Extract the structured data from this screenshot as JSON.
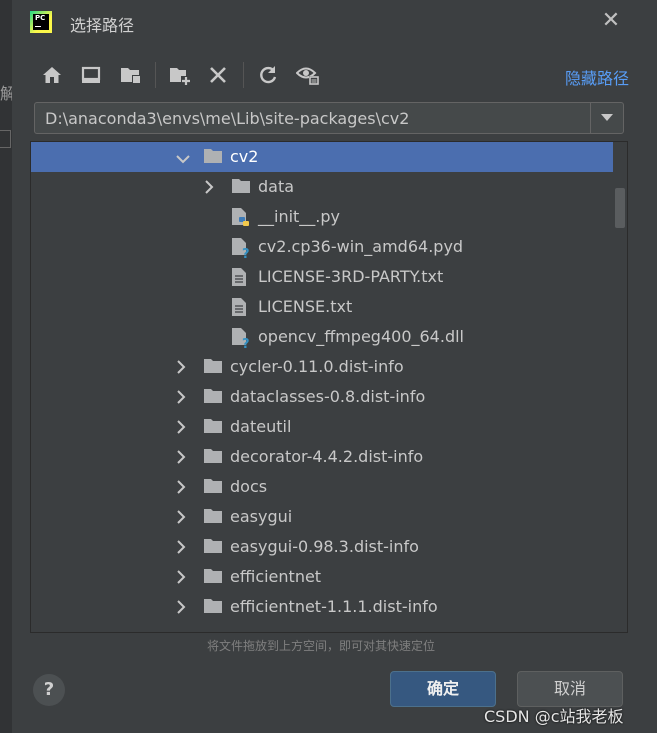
{
  "window": {
    "title": "选择路径",
    "close_glyph": "✕"
  },
  "background_fragments": {
    "left_text": "解"
  },
  "toolbar": {
    "icons": [
      "home-icon",
      "desktop-icon",
      "project-folder-icon",
      "new-folder-icon",
      "delete-icon",
      "refresh-icon",
      "show-hidden-icon"
    ],
    "hide_path_label": "隐藏路径"
  },
  "path": {
    "value": "D:\\anaconda3\\envs\\me\\Lib\\site-packages\\cv2"
  },
  "tree": {
    "rows": [
      {
        "label": "cv2",
        "type": "folder",
        "state": "expanded",
        "selected": true
      },
      {
        "label": "data",
        "type": "folder",
        "state": "collapsed",
        "selected": false
      },
      {
        "label": "__init__.py",
        "type": "python-file",
        "state": "none",
        "selected": false
      },
      {
        "label": "cv2.cp36-win_amd64.pyd",
        "type": "unknown-file",
        "state": "none",
        "selected": false
      },
      {
        "label": "LICENSE-3RD-PARTY.txt",
        "type": "text-file",
        "state": "none",
        "selected": false
      },
      {
        "label": "LICENSE.txt",
        "type": "text-file",
        "state": "none",
        "selected": false
      },
      {
        "label": "opencv_ffmpeg400_64.dll",
        "type": "unknown-file",
        "state": "none",
        "selected": false
      },
      {
        "label": "cycler-0.11.0.dist-info",
        "type": "folder",
        "state": "collapsed",
        "selected": false
      },
      {
        "label": "dataclasses-0.8.dist-info",
        "type": "folder",
        "state": "collapsed",
        "selected": false
      },
      {
        "label": "dateutil",
        "type": "folder",
        "state": "collapsed",
        "selected": false
      },
      {
        "label": "decorator-4.4.2.dist-info",
        "type": "folder",
        "state": "collapsed",
        "selected": false
      },
      {
        "label": "docs",
        "type": "folder",
        "state": "collapsed",
        "selected": false
      },
      {
        "label": "easygui",
        "type": "folder",
        "state": "collapsed",
        "selected": false
      },
      {
        "label": "easygui-0.98.3.dist-info",
        "type": "folder",
        "state": "collapsed",
        "selected": false
      },
      {
        "label": "efficientnet",
        "type": "folder",
        "state": "collapsed",
        "selected": false
      },
      {
        "label": "efficientnet-1.1.1.dist-info",
        "type": "folder",
        "state": "collapsed",
        "selected": false
      }
    ]
  },
  "hint": "将文件拖放到上方空间，即可对其快速定位",
  "buttons": {
    "help": "?",
    "ok": "确定",
    "cancel": "取消"
  },
  "watermark": "CSDN @c站我老板",
  "colors": {
    "dialog_bg": "#3c3f41",
    "selection": "#4b6eaf",
    "link": "#589df6",
    "ok_button": "#365880",
    "folder": "#afb1b3"
  }
}
